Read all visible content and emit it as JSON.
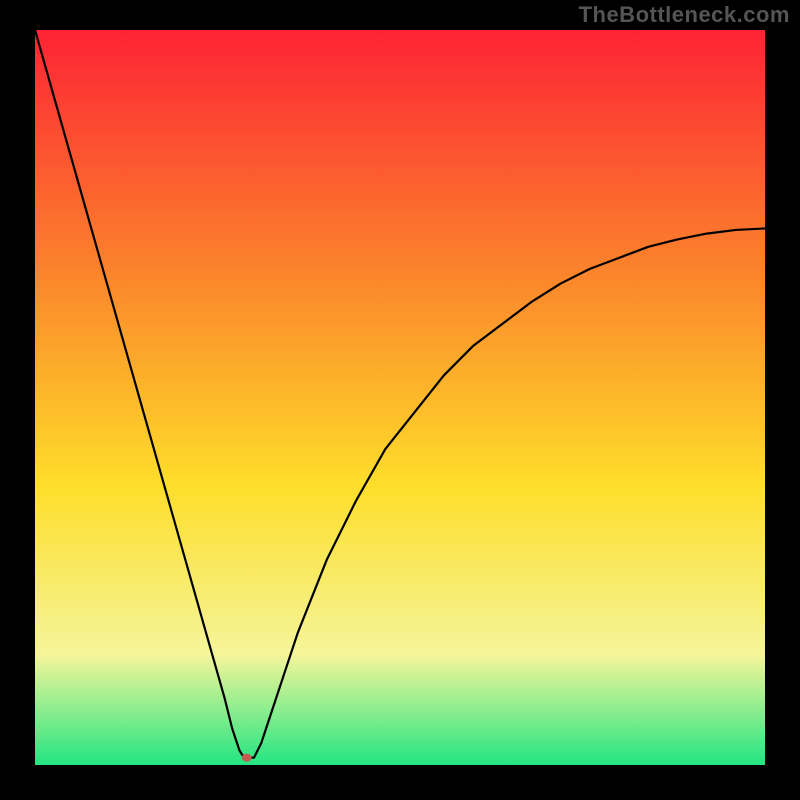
{
  "watermark": "TheBottleneck.com",
  "chart_data": {
    "type": "line",
    "title": "",
    "xlabel": "",
    "ylabel": "",
    "xlim": [
      0,
      100
    ],
    "ylim": [
      0,
      100
    ],
    "grid": false,
    "legend": false,
    "background_gradient": {
      "top_color": "#fd2335",
      "mid_color": "#fede2a",
      "bottom_color": "#23e582"
    },
    "series": [
      {
        "name": "bottleneck-curve",
        "x": [
          0,
          2,
          4,
          6,
          8,
          10,
          12,
          14,
          16,
          18,
          20,
          22,
          24,
          26,
          27,
          28,
          28.5,
          29,
          30,
          31,
          32,
          34,
          36,
          38,
          40,
          44,
          48,
          52,
          56,
          60,
          64,
          68,
          72,
          76,
          80,
          84,
          88,
          92,
          96,
          100
        ],
        "values": [
          100,
          93,
          86,
          79,
          72,
          65,
          58,
          51,
          44,
          37,
          30,
          23,
          16,
          9,
          5,
          2,
          1.2,
          1,
          1,
          3,
          6,
          12,
          18,
          23,
          28,
          36,
          43,
          48,
          53,
          57,
          60,
          63,
          65.5,
          67.5,
          69,
          70.5,
          71.5,
          72.3,
          72.8,
          73
        ]
      }
    ],
    "marker": {
      "name": "optimal-point",
      "x": 29,
      "y": 1,
      "rx": 5,
      "ry": 4,
      "color": "#c45a52"
    }
  }
}
